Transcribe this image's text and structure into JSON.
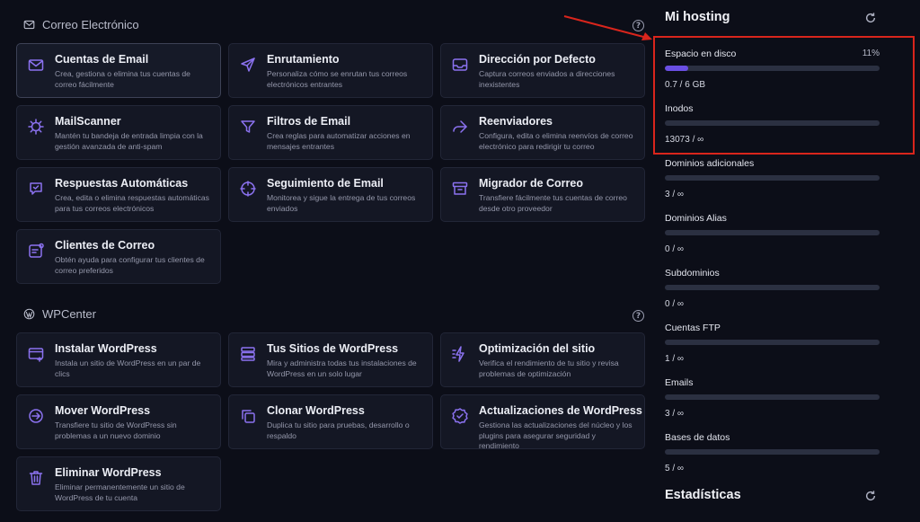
{
  "email_section": {
    "title": "Correo Electrónico",
    "cards": [
      {
        "title": "Cuentas de Email",
        "desc": "Crea, gestiona o elimina tus cuentas de correo fácilmente",
        "icon": "envelope-icon"
      },
      {
        "title": "Enrutamiento",
        "desc": "Personaliza cómo se enrutan tus correos electrónicos entrantes",
        "icon": "send-icon"
      },
      {
        "title": "Dirección por Defecto",
        "desc": "Captura correos enviados a direcciones inexistentes",
        "icon": "inbox-icon"
      },
      {
        "title": "MailScanner",
        "desc": "Mantén tu bandeja de entrada limpia con la gestión avanzada de anti-spam",
        "icon": "virus-icon"
      },
      {
        "title": "Filtros de Email",
        "desc": "Crea reglas para automatizar acciones en mensajes entrantes",
        "icon": "filter-icon"
      },
      {
        "title": "Reenviadores",
        "desc": "Configura, edita o elimina reenvíos de correo electrónico para redirigir tu correo",
        "icon": "forward-icon"
      },
      {
        "title": "Respuestas Automáticas",
        "desc": "Crea, edita o elimina respuestas automáticas para tus correos electrónicos",
        "icon": "auto-reply-icon"
      },
      {
        "title": "Seguimiento de Email",
        "desc": "Monitorea y sigue la entrega de tus correos enviados",
        "icon": "crosshair-icon"
      },
      {
        "title": "Migrador de Correo",
        "desc": "Transfiere fácilmente tus cuentas de correo desde otro proveedor",
        "icon": "archive-icon"
      },
      {
        "title": "Clientes de Correo",
        "desc": "Obtén ayuda para configurar tus clientes de correo preferidos",
        "icon": "mail-client-icon"
      }
    ]
  },
  "wp_section": {
    "title": "WPCenter",
    "cards": [
      {
        "title": "Instalar WordPress",
        "desc": "Instala un sitio de WordPress en un par de clics",
        "icon": "install-icon"
      },
      {
        "title": "Tus Sitios de WordPress",
        "desc": "Mira y administra todas tus instalaciones de WordPress en un solo lugar",
        "icon": "sites-icon"
      },
      {
        "title": "Optimización del sitio",
        "desc": "Verifica el rendimiento de tu sitio y revisa problemas de optimización",
        "icon": "speed-icon"
      },
      {
        "title": "Mover WordPress",
        "desc": "Transfiere tu sitio de WordPress sin problemas a un nuevo dominio",
        "icon": "move-icon"
      },
      {
        "title": "Clonar WordPress",
        "desc": "Duplica tu sitio para pruebas, desarrollo o respaldo",
        "icon": "clone-icon"
      },
      {
        "title": "Actualizaciones de WordPress",
        "desc": "Gestiona las actualizaciones del núcleo y los plugins para asegurar seguridad y rendimiento",
        "icon": "badge-check-icon"
      },
      {
        "title": "Eliminar WordPress",
        "desc": "Eliminar permanentemente un sitio de WordPress de tu cuenta",
        "icon": "trash-icon"
      }
    ]
  },
  "sidebar": {
    "title": "Mi hosting",
    "stats_title": "Estadísticas",
    "stats": [
      {
        "label": "Espacio en disco",
        "percent": "11%",
        "value": "0.7 / 6 GB",
        "fill": 0.11
      },
      {
        "label": "Inodos",
        "percent": "",
        "value": "13073 / ∞",
        "fill": 0
      },
      {
        "label": "Dominios adicionales",
        "percent": "",
        "value": "3 / ∞",
        "fill": 0
      },
      {
        "label": "Dominios Alias",
        "percent": "",
        "value": "0 / ∞",
        "fill": 0
      },
      {
        "label": "Subdominios",
        "percent": "",
        "value": "0 / ∞",
        "fill": 0
      },
      {
        "label": "Cuentas FTP",
        "percent": "",
        "value": "1 / ∞",
        "fill": 0
      },
      {
        "label": "Emails",
        "percent": "",
        "value": "3 / ∞",
        "fill": 0
      },
      {
        "label": "Bases de datos",
        "percent": "",
        "value": "5 / ∞",
        "fill": 0
      }
    ]
  },
  "colors": {
    "accent": "#6a4fe3",
    "highlight": "#d9251c",
    "background": "#0c0e18"
  }
}
